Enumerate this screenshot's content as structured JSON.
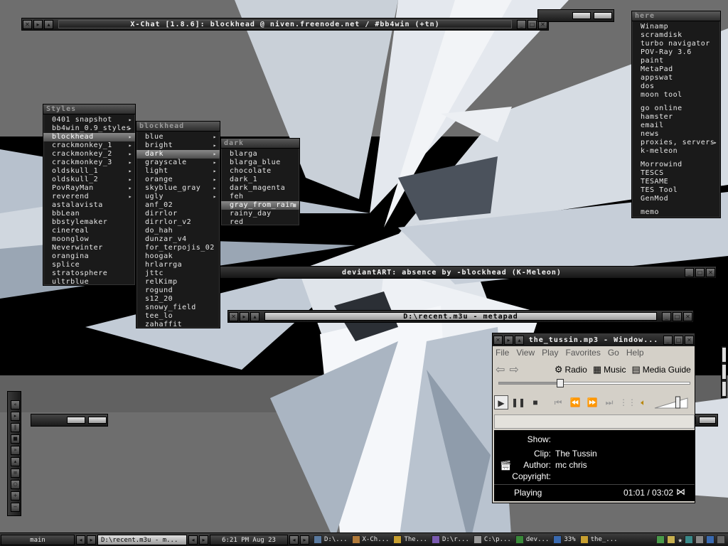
{
  "xchat": {
    "title": "X-Chat [1.8.6]: blockhead @ niven.freenode.net / #bb4win (+tn)"
  },
  "deviantart": {
    "title": "deviantART: absence by -blockhead (K-Meleon)"
  },
  "metapad": {
    "title": "D:\\recent.m3u - metapad"
  },
  "styles_menu": {
    "title": "Styles",
    "items": [
      "0401 snapshot",
      "bb4win_0.9_styles",
      "blockhead",
      "crackmonkey_1",
      "crackmonkey_2",
      "crackmonkey_3",
      "oldskull_1",
      "oldskull_2",
      "PovRayMan",
      "reverend",
      "astalavista",
      "bbLean",
      "bbstylemaker",
      "cinereal",
      "moonglow",
      "Neverwinter",
      "orangina",
      "splice",
      "stratosphere",
      "ultrblue"
    ],
    "selected": "blockhead"
  },
  "blockhead_menu": {
    "title": "blockhead",
    "items": [
      "blue",
      "bright",
      "dark",
      "grayscale",
      "light",
      "orange",
      "skyblue_gray",
      "ugly",
      "anf_02",
      "dirrlor",
      "dirrlor_v2",
      "do_hah",
      "dunzar_v4",
      "for_terpojis_02",
      "hoogak",
      "hrlarrga",
      "jttc",
      "relKimp",
      "rogund",
      "s12_20",
      "snowy_field",
      "tee_lo",
      "zahaffit"
    ],
    "selected": "dark"
  },
  "dark_menu": {
    "title": "dark",
    "items": [
      "blarga",
      "blarga_blue",
      "chocolate",
      "dark_1",
      "dark_magenta",
      "feh",
      "gray_from_rain",
      "rainy_day",
      "red"
    ],
    "selected": "gray_from_rain"
  },
  "root_menu": {
    "title": "here",
    "items": [
      "Winamp",
      "scramdisk",
      "turbo navigator",
      "POV-Ray 3.6",
      "paint",
      "MetaPad",
      "appswat",
      "dos",
      "moon tool",
      "go online",
      "hamster",
      "email",
      "news",
      "proxies, servers",
      "k-meleon",
      "Morrowind",
      "TESCS",
      "TESAME",
      "TES Tool",
      "GenMod",
      "memo"
    ]
  },
  "media_player": {
    "title": "the_tussin.mp3 - Window...",
    "menu": [
      "File",
      "View",
      "Play",
      "Favorites",
      "Go",
      "Help"
    ],
    "nav": [
      "Radio",
      "Music",
      "Media Guide"
    ],
    "seek_fraction": 0.32,
    "volume_fraction": 0.7,
    "show_label": "Show:",
    "clip_label": "Clip:",
    "clip_value": "The Tussin",
    "author_label": "Author:",
    "author_value": "mc chris",
    "copyright_label": "Copyright:",
    "status": "Playing",
    "time": "01:01 / 03:02"
  },
  "taskbar": {
    "workspace": "main",
    "active_task": "D:\\recent.m3u - m...",
    "clock": "6:21 PM Aug 23",
    "tasks": [
      "D:\\...",
      "X-Ch...",
      "The...",
      "D:\\r...",
      "C:\\p...",
      "dev...",
      "33%",
      "the_..."
    ]
  },
  "colors": {
    "wall_dark": "#000000",
    "wall_gray": "#6e6e6e",
    "shard_light": "#e0e6ee",
    "shard_mid": "#aeb8c6"
  }
}
